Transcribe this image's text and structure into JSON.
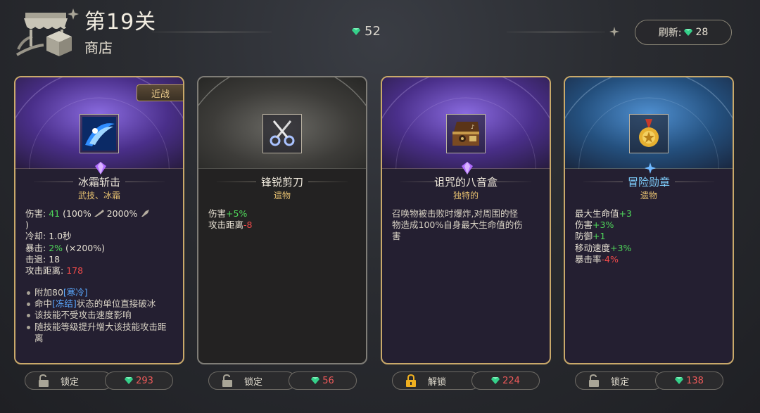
{
  "header": {
    "level": "第19关",
    "subtitle": "商店",
    "gem_balance": "52",
    "refresh_label": "刷新:",
    "refresh_cost": "28"
  },
  "colors": {
    "gold_border": "#c9a96a",
    "gem_green": "#35d08a",
    "price_red": "#ef5a5a",
    "stat_green": "#4fd65a",
    "stat_red": "#ef4a4a",
    "tag_blue": "#5aa8ff"
  },
  "cards": [
    {
      "name": "冰霜斩击",
      "sub": "武技、冰霜",
      "tag": "近战",
      "icon": "frost-slash-icon",
      "stats": {
        "damage_label": "伤害:",
        "damage_value": "41",
        "damage_rest": "(100%",
        "damage_rest2": "2000%",
        "damage_close": ")",
        "cooldown_label": "冷却:",
        "cooldown_value": "1.0秒",
        "crit_label": "暴击:",
        "crit_value": "2%",
        "crit_rest": "(×200%)",
        "knockback_label": "击退:",
        "knockback_value": "18",
        "range_label": "攻击距离:",
        "range_value": "178"
      },
      "bullets": {
        "b1_a": "附加80",
        "b1_tag": "[寒冷]",
        "b2_a": "命中",
        "b2_tag": "[冻结]",
        "b2_b": "状态的单位直接破冰",
        "b3": "该技能不受攻击速度影响",
        "b4": "随技能等级提升增大该技能攻击距离"
      },
      "lock_label": "锁定",
      "price": "293"
    },
    {
      "name": "锋锐剪刀",
      "sub": "遗物",
      "icon": "scissors-icon",
      "stats": {
        "s1_label": "伤害",
        "s1_value": "+5%",
        "s2_label": "攻击距离",
        "s2_value": "-8"
      },
      "lock_label": "锁定",
      "price": "56"
    },
    {
      "name": "诅咒的八音盒",
      "sub": "独特的",
      "icon": "music-box-icon",
      "desc": "召唤物被击败时爆炸,对周围的怪物造成100%自身最大生命值的伤害",
      "lock_label": "解锁",
      "price": "224"
    },
    {
      "name": "冒险勋章",
      "sub": "遗物",
      "icon": "medal-icon",
      "stats": {
        "s1_label": "最大生命值",
        "s1_value": "+3",
        "s2_label": "伤害",
        "s2_value": "+3%",
        "s3_label": "防御",
        "s3_value": "+1",
        "s4_label": "移动速度",
        "s4_value": "+3%",
        "s5_label": "暴击率",
        "s5_value": "-4%"
      },
      "lock_label": "锁定",
      "price": "138"
    }
  ]
}
